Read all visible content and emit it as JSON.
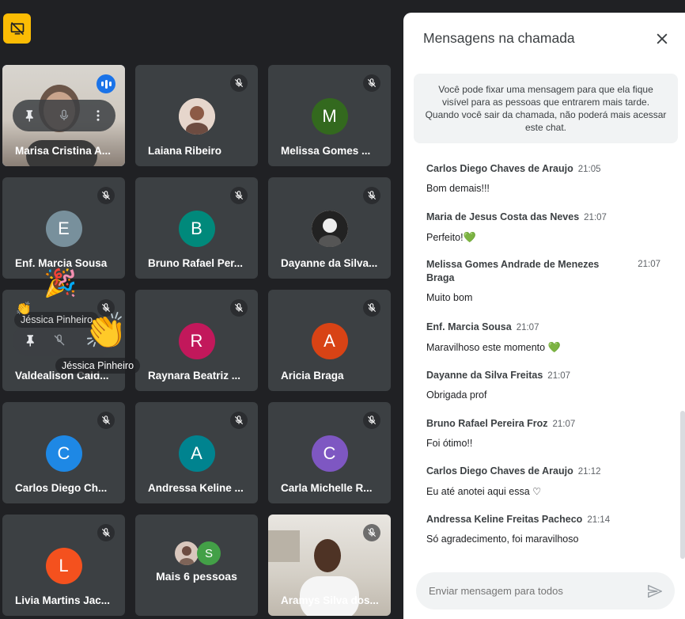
{
  "tiles": [
    {
      "name": "Marisa Cristina A...",
      "kind": "video"
    },
    {
      "name": "Laiana Ribeiro",
      "kind": "photo"
    },
    {
      "name": "Melissa Gomes ...",
      "initial": "M",
      "color": "#33691e"
    },
    {
      "name": "Enf. Marcia Sousa",
      "initial": "E",
      "color": "#78909c"
    },
    {
      "name": "Bruno Rafael Per...",
      "initial": "B",
      "color": "#00897b"
    },
    {
      "name": "Dayanne da Silva...",
      "kind": "photo"
    },
    {
      "name": "Valdealison Cald...",
      "kind": "hover"
    },
    {
      "name": "Raynara Beatriz ...",
      "initial": "R",
      "color": "#c2185b"
    },
    {
      "name": "Aricia Braga",
      "initial": "A",
      "color": "#d84315"
    },
    {
      "name": "Carlos Diego Ch...",
      "initial": "C",
      "color": "#1e88e5"
    },
    {
      "name": "Andressa Keline ...",
      "initial": "A",
      "color": "#00838f"
    },
    {
      "name": "Carla Michelle R...",
      "initial": "C",
      "color": "#7e57c2"
    },
    {
      "name": "Livia Martins Jac...",
      "initial": "L",
      "color": "#f4511e"
    },
    {
      "name": "Mais 6 pessoas",
      "kind": "more",
      "mini_initial": "S"
    },
    {
      "name": "Aramys Silva dos...",
      "kind": "video2"
    }
  ],
  "reactions": {
    "label_top": "Jéssica Pinheiro",
    "label_bottom": "Jéssica Pinheiro"
  },
  "chat": {
    "title": "Mensagens na chamada",
    "info": "Você pode fixar uma mensagem para que ela fique visível para as pessoas que entrarem mais tarde. Quando você sair da chamada, não poderá mais acessar este chat.",
    "messages": [
      {
        "sender": "Carlos Diego Chaves de Araujo",
        "time": "21:05",
        "text": "Bom demais!!!"
      },
      {
        "sender": "Maria de Jesus Costa das Neves",
        "time": "21:07",
        "text": "Perfeito!",
        "heart": true
      },
      {
        "sender": "Melissa Gomes Andrade de Menezes Braga",
        "time": "21:07",
        "text": "Muito bom"
      },
      {
        "sender": "Enf. Marcia Sousa",
        "time": "21:07",
        "text": "Maravilhoso este momento ",
        "heart": true
      },
      {
        "sender": "Dayanne da Silva Freitas",
        "time": "21:07",
        "text": "Obrigada prof"
      },
      {
        "sender": "Bruno Rafael Pereira Froz",
        "time": "21:07",
        "text": "Foi ótimo!!"
      },
      {
        "sender": "Carlos Diego Chaves de Araujo",
        "time": "21:12",
        "text": "Eu até anotei aqui essa ♡"
      },
      {
        "sender": "Andressa Keline Freitas Pacheco",
        "time": "21:14",
        "text": "Só agradecimento, foi maravilhoso"
      }
    ],
    "input_placeholder": "Enviar mensagem para todos"
  }
}
